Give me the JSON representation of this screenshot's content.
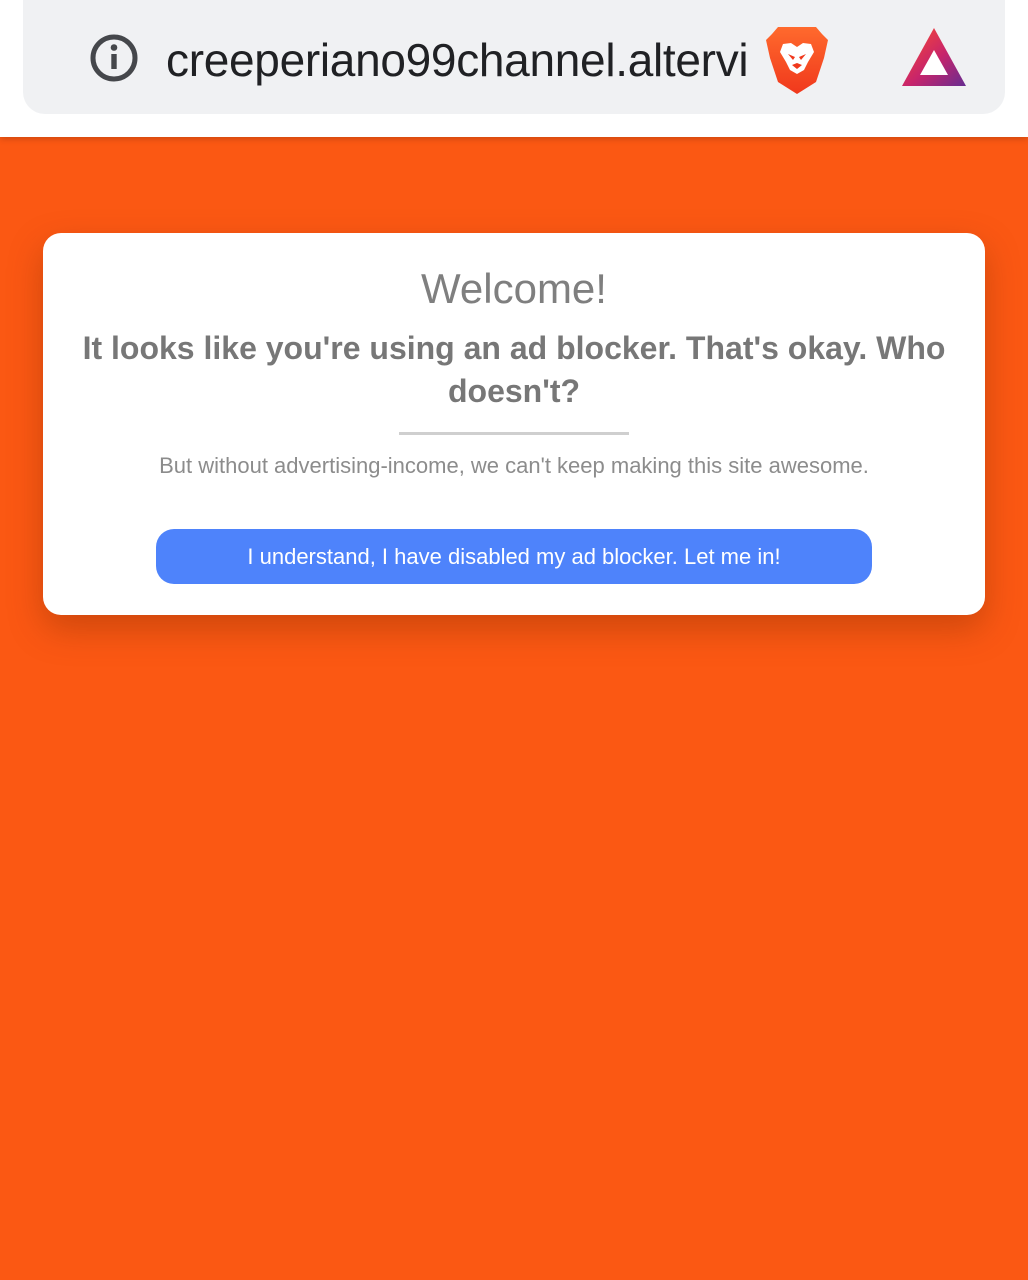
{
  "browser": {
    "url_display": "creeperiano99channel.altervi",
    "icons": {
      "site_info": "info-circle-icon",
      "shields": "brave-shields-lion-icon",
      "rewards": "brave-rewards-triangle-icon"
    }
  },
  "modal": {
    "title": "Welcome!",
    "headline": "It looks like you're using an ad blocker. That's okay. Who doesn't?",
    "message": "But without advertising-income, we can't keep making this site awesome.",
    "button_label": "I understand, I have disabled my ad blocker. Let me in!"
  },
  "colors": {
    "page_background": "#fb5813",
    "button": "#4e83fb",
    "shields_orange": "#fb542b",
    "rewards_purple": "#662d91"
  }
}
